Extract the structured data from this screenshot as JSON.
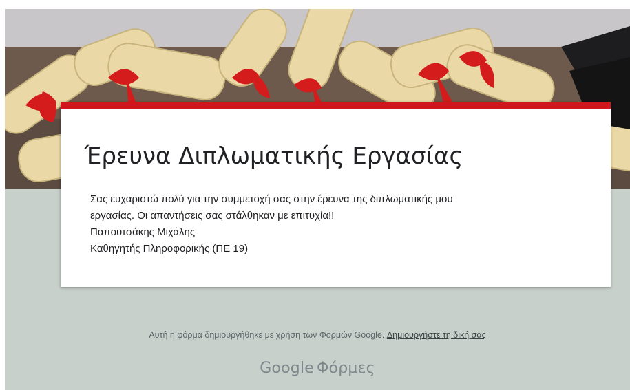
{
  "form": {
    "title": "Έρευνα Διπλωματικής Εργασίας",
    "message_lines": [
      "Σας ευχαριστώ πολύ για την συμμετοχή σας στην έρευνα της διπλωματικής μου",
      "εργασίας. Οι απαντήσεις σας στάλθηκαν με επιτυχία!!",
      "Παπουτσάκης Μιχάλης",
      "Καθηγητής Πληροφορικής (ΠΕ 19)"
    ]
  },
  "footer": {
    "note": "Αυτή η φόρμα δημιουργήθηκε με χρήση των Φορμών Google.",
    "create_link": "Δημιουργήστε τη δική σας"
  },
  "logo": {
    "brand": "Google",
    "product": "Φόρμες"
  },
  "theme": {
    "accent": "#d0161c",
    "background": "#c8d0cb"
  },
  "icons": {
    "banner": "graduation-diplomas-illustration"
  }
}
